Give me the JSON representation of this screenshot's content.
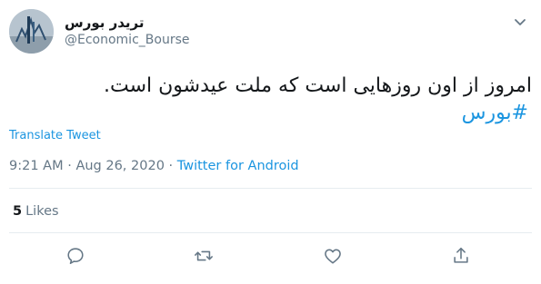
{
  "author": {
    "display_name": "تریدر بورس",
    "handle": "@Economic_Bourse",
    "avatar_icon": "avatar-image"
  },
  "tweet": {
    "text": "امروز از اون روزهایی است که ملت عیدشون است.",
    "hashtag": "#بورس"
  },
  "translate_label": "Translate Tweet",
  "timestamp": {
    "time": "9:21 AM",
    "separator": " · ",
    "date": "Aug 26, 2020",
    "source": "Twitter for Android"
  },
  "engagement": {
    "likes_count": "5",
    "likes_label": "Likes"
  },
  "actions": {
    "reply_icon": "reply-icon",
    "retweet_icon": "retweet-icon",
    "like_icon": "heart-icon",
    "share_icon": "share-icon"
  },
  "colors": {
    "link": "#1b95e0",
    "secondary_text": "#657786",
    "divider": "#e6ecf0"
  }
}
